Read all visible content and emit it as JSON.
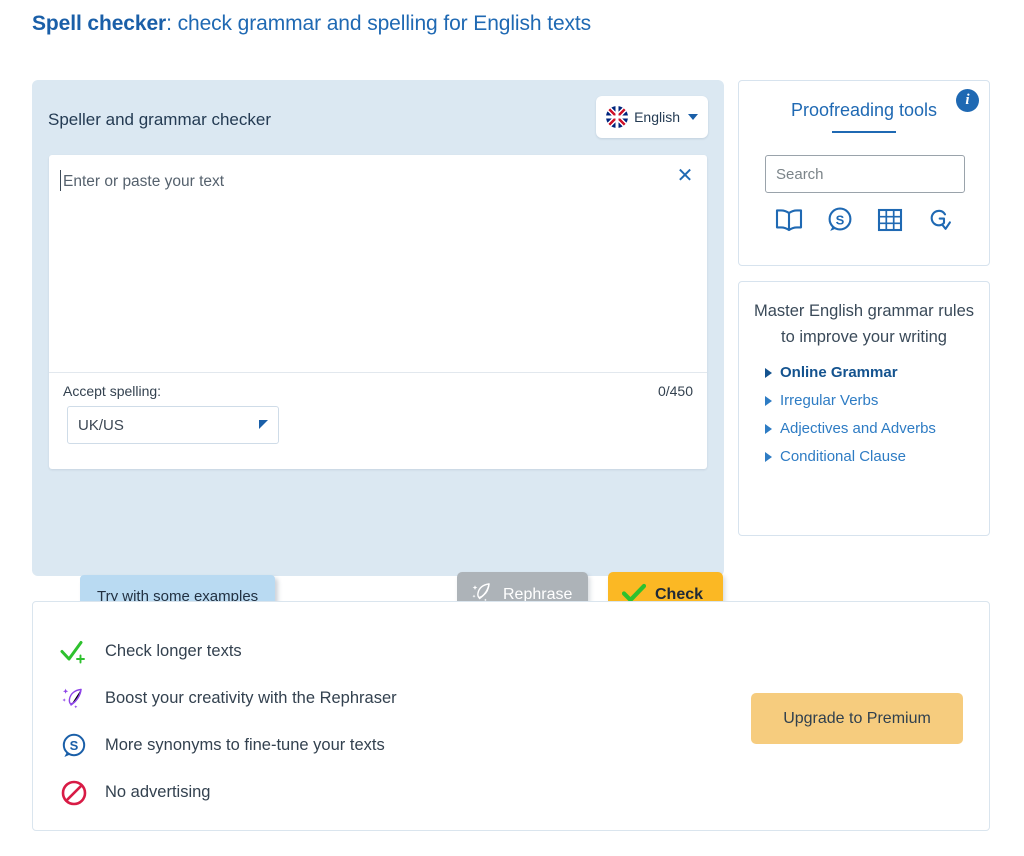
{
  "title": {
    "bold": "Spell checker",
    "rest": ": check grammar and spelling for English texts"
  },
  "checker": {
    "heading": "Speller and grammar checker",
    "language": {
      "label": "English",
      "icon": "uk-flag-icon"
    },
    "editor": {
      "placeholder": "Enter or paste your text",
      "clear_icon": "close-x-icon",
      "accept_spelling_label": "Accept spelling:",
      "variant_value": "UK/US",
      "counter": "0/450"
    },
    "buttons": {
      "examples": "Try with some examples",
      "rephrase": "Rephrase",
      "check": "Check"
    }
  },
  "tools": {
    "title": "Proofreading tools",
    "info_icon": "info-icon",
    "search_placeholder": "Search",
    "icons": [
      {
        "name": "dictionary-book-icon"
      },
      {
        "name": "synonyms-s-icon"
      },
      {
        "name": "conjugation-grid-icon"
      },
      {
        "name": "grammar-g-check-icon"
      }
    ]
  },
  "grammar": {
    "heading": "Master English grammar rules to improve your writing",
    "links": [
      {
        "label": "Online Grammar",
        "primary": true
      },
      {
        "label": "Irregular Verbs",
        "primary": false
      },
      {
        "label": "Adjectives and Adverbs",
        "primary": false
      },
      {
        "label": "Conditional Clause",
        "primary": false
      }
    ]
  },
  "premium": {
    "benefits": [
      {
        "icon": "check-plus-icon",
        "text": "Check longer texts"
      },
      {
        "icon": "feather-sparkle-icon",
        "text": "Boost your creativity with the Rephraser"
      },
      {
        "icon": "synonyms-s-icon",
        "text": "More synonyms to fine-tune your texts"
      },
      {
        "icon": "no-advertising-icon",
        "text": "No advertising"
      }
    ],
    "upgrade_label": "Upgrade to Premium"
  },
  "colors": {
    "brand_blue": "#1f69b3",
    "panel_blue": "#dbe8f2",
    "check_amber": "#fbb824",
    "upgrade_amber": "#f6cc7e",
    "examples_blue": "#b9daf2",
    "rephrase_grey": "#adb3b8",
    "green": "#2ec12e",
    "purple": "#8e44e8",
    "red": "#d81b45"
  }
}
